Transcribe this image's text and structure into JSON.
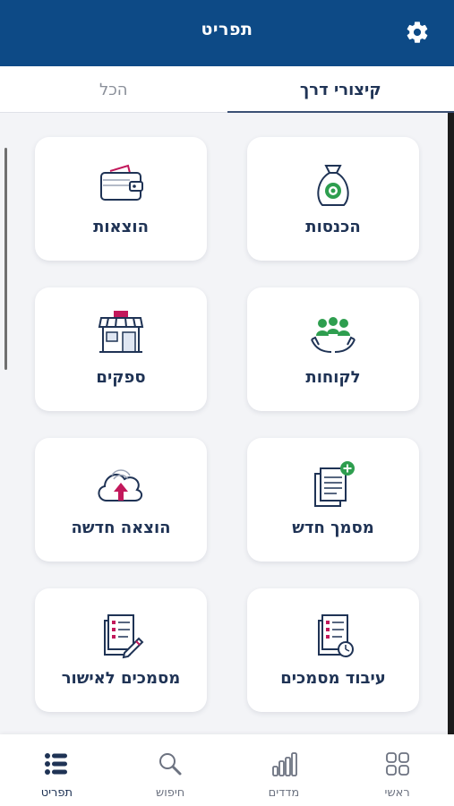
{
  "header": {
    "title": "תפריט",
    "settings_icon": "gear-icon"
  },
  "tabs": [
    {
      "label": "קיצורי דרך",
      "active": true
    },
    {
      "label": "הכל",
      "active": false
    }
  ],
  "cards": [
    {
      "label": "הכנסות",
      "icon": "money-bag-icon"
    },
    {
      "label": "הוצאות",
      "icon": "wallet-icon"
    },
    {
      "label": "לקוחות",
      "icon": "customers-icon"
    },
    {
      "label": "ספקים",
      "icon": "store-icon"
    },
    {
      "label": "מסמך חדש",
      "icon": "new-document-icon"
    },
    {
      "label": "הוצאה חדשה",
      "icon": "cloud-upload-icon"
    },
    {
      "label": "עיבוד מסמכים",
      "icon": "document-processing-icon"
    },
    {
      "label": "מסמכים לאישור",
      "icon": "documents-approval-icon"
    }
  ],
  "bottom_nav": [
    {
      "label": "ראשי",
      "icon": "grid-icon",
      "active": false
    },
    {
      "label": "מדדים",
      "icon": "bar-chart-icon",
      "active": false
    },
    {
      "label": "חיפוש",
      "icon": "search-icon",
      "active": false
    },
    {
      "label": "תפריט",
      "icon": "menu-list-icon",
      "active": true
    }
  ],
  "colors": {
    "header_bg": "#0d4a86",
    "accent_pink": "#c2185b",
    "accent_green": "#2e9e4f",
    "text_dark": "#1f3355"
  }
}
